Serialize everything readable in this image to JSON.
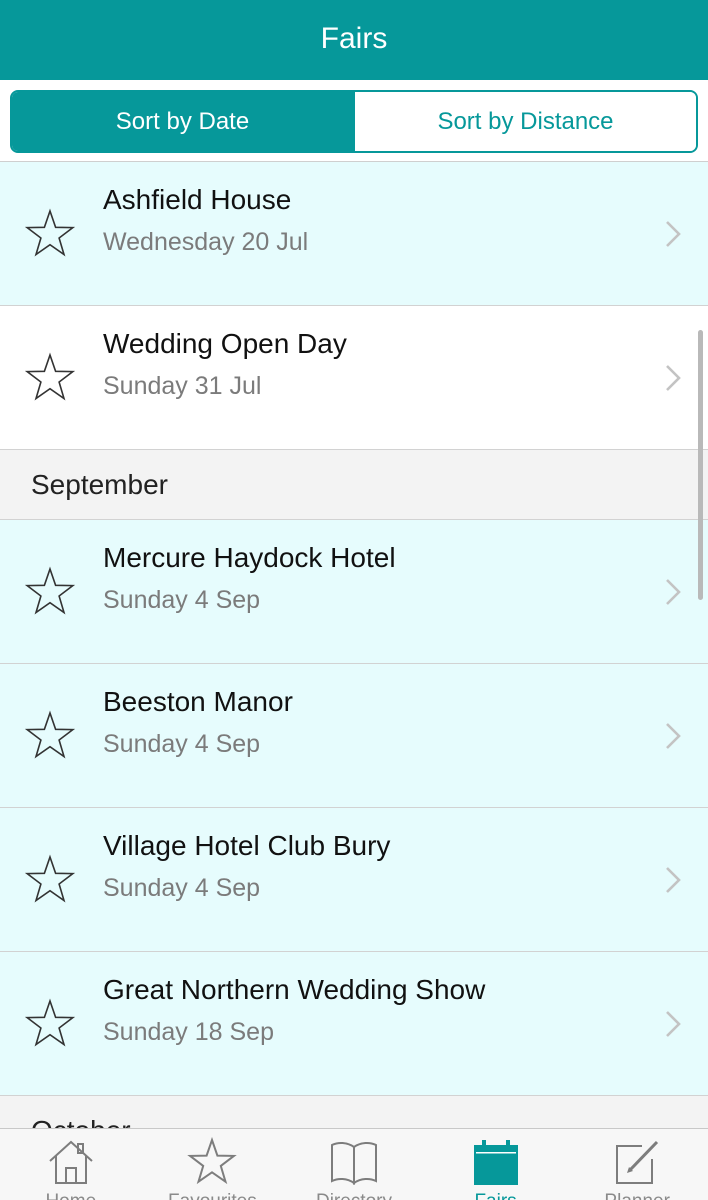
{
  "navbar": {
    "title": "Fairs"
  },
  "segment": {
    "sort_by_date": "Sort by Date",
    "sort_by_distance": "Sort by Distance"
  },
  "list": {
    "top_rows": [
      {
        "name": "Ashfield House",
        "date": "Wednesday 20 Jul",
        "highlighted": true
      },
      {
        "name": "Wedding Open Day",
        "date": "Sunday 31 Jul",
        "highlighted": false
      }
    ],
    "september": {
      "header": "September",
      "rows": [
        {
          "name": "Mercure Haydock Hotel",
          "date": "Sunday 4 Sep"
        },
        {
          "name": "Beeston Manor",
          "date": "Sunday 4 Sep"
        },
        {
          "name": "Village Hotel Club Bury",
          "date": "Sunday 4 Sep"
        },
        {
          "name": "Great Northern Wedding Show",
          "date": "Sunday 18 Sep"
        }
      ]
    },
    "october": {
      "header": "October"
    }
  },
  "tabbar": {
    "tabs": [
      {
        "label": "Home",
        "icon": "home-icon"
      },
      {
        "label": "Favourites",
        "icon": "star-icon"
      },
      {
        "label": "Directory",
        "icon": "book-icon"
      },
      {
        "label": "Fairs",
        "icon": "calendar-icon",
        "active": true
      },
      {
        "label": "Planner",
        "icon": "edit-icon"
      }
    ]
  },
  "colors": {
    "accent": "#06989a",
    "highlight_row": "#e6fcfd",
    "section_bg": "#f3f3f3"
  }
}
